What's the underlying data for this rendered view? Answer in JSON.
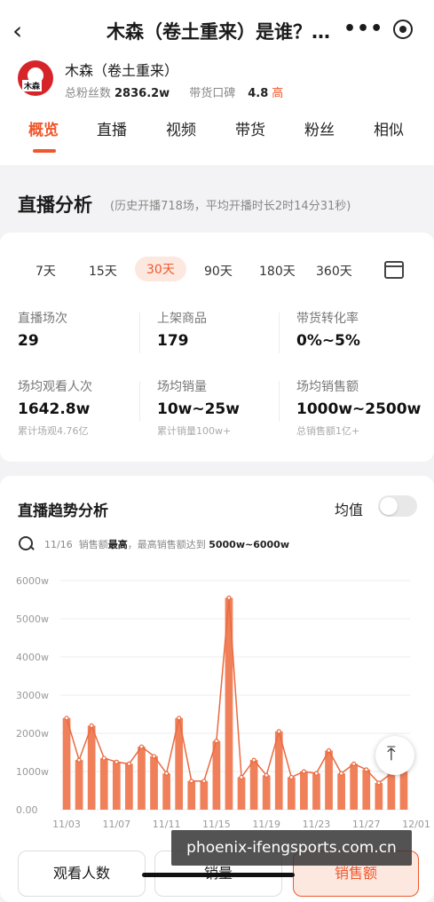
{
  "header": {
    "back_icon": "‹",
    "title": "木森（卷土重来）是谁？…",
    "more_icon": "•••"
  },
  "profile": {
    "avatar_text": "木森",
    "name": "木森（卷土重来）",
    "fans_label": "总粉丝数",
    "fans_value": "2836.2w",
    "reputation_label": "带货口碑",
    "reputation_value": "4.8",
    "reputation_level": "高"
  },
  "tabs": [
    "概览",
    "直播",
    "视频",
    "带货",
    "粉丝",
    "相似"
  ],
  "live_analysis": {
    "title": "直播分析",
    "subtitle": "(历史开播718场，平均开播时长2时14分31秒)",
    "periods": [
      "7天",
      "15天",
      "30天",
      "90天",
      "180天",
      "360天"
    ],
    "active_period": "30天",
    "metrics": [
      {
        "label": "直播场次",
        "value": "29",
        "note": ""
      },
      {
        "label": "上架商品",
        "value": "179",
        "note": ""
      },
      {
        "label": "带货转化率",
        "value": "0%~5%",
        "note": ""
      },
      {
        "label": "场均观看人次",
        "value": "1642.8w",
        "note": "累计场观4.76亿"
      },
      {
        "label": "场均销量",
        "value": "10w~25w",
        "note": "累计销量100w+"
      },
      {
        "label": "场均销售额",
        "value": "1000w~2500w",
        "note": "总销售额1亿+"
      }
    ]
  },
  "trend": {
    "title": "直播趋势分析",
    "avg_label": "均值",
    "insight_date": "11/16",
    "insight_text1": "销售额",
    "insight_bold": "最高",
    "insight_text2": "，最高销售额达到",
    "insight_value": "5000w~6000w"
  },
  "chart_data": {
    "type": "bar",
    "ylim": [
      0,
      6000
    ],
    "yticks": [
      "0.00",
      "1000w",
      "2000w",
      "3000w",
      "4000w",
      "5000w",
      "6000w"
    ],
    "xticks": [
      "11/03",
      "11/07",
      "11/11",
      "11/15",
      "11/19",
      "11/23",
      "11/27",
      "12/01"
    ],
    "values": [
      2400,
      1300,
      2200,
      1350,
      1250,
      1200,
      1650,
      1400,
      950,
      2400,
      750,
      750,
      1800,
      5550,
      850,
      1300,
      900,
      2050,
      850,
      1000,
      950,
      1550,
      950,
      1200,
      1050,
      700,
      950,
      1000
    ],
    "color": "#f0805a",
    "line_color": "#ea6a40"
  },
  "bottom_tabs": [
    {
      "label": "观看人数",
      "active": false
    },
    {
      "label": "销量",
      "active": false
    },
    {
      "label": "销售额",
      "active": true
    }
  ],
  "watermark": "phoenix-ifengsports.com.cn",
  "totop_icon": "⤒"
}
